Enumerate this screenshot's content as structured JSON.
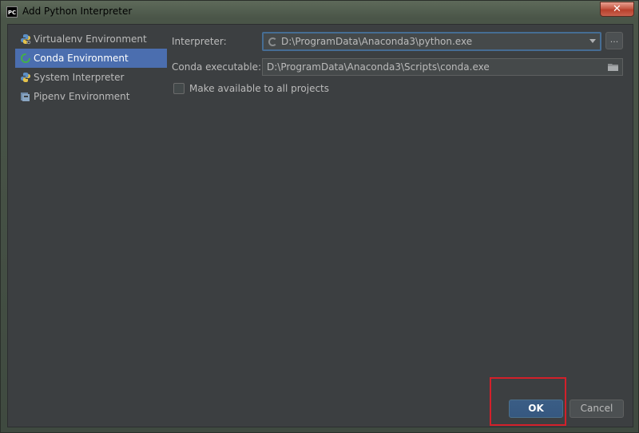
{
  "window": {
    "title": "Add Python Interpreter",
    "app_icon_text": "PC",
    "close_label": "✕"
  },
  "sidebar": {
    "items": [
      {
        "label": "Virtualenv Environment",
        "icon": "virtualenv-icon",
        "selected": false
      },
      {
        "label": "Conda Environment",
        "icon": "conda-icon",
        "selected": true
      },
      {
        "label": "System Interpreter",
        "icon": "python-icon",
        "selected": false
      },
      {
        "label": "Pipenv Environment",
        "icon": "pipenv-icon",
        "selected": false
      }
    ]
  },
  "form": {
    "interpreter_label": "Interpreter:",
    "interpreter_value": "D:\\ProgramData\\Anaconda3\\python.exe",
    "browse_label": "...",
    "conda_label": "Conda executable:",
    "conda_value": "D:\\ProgramData\\Anaconda3\\Scripts\\conda.exe",
    "make_available_label": "Make available to all projects",
    "make_available_checked": false
  },
  "buttons": {
    "ok": "OK",
    "cancel": "Cancel"
  },
  "colors": {
    "accent_selection": "#4b6eaf",
    "highlight_annotation": "#d3202a",
    "panel_background": "#3c3f41"
  }
}
